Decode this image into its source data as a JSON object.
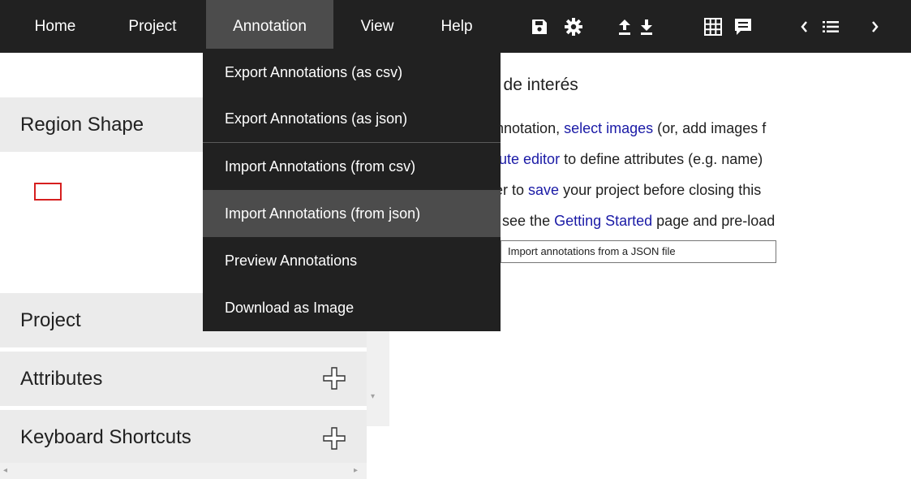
{
  "menubar": {
    "items": [
      {
        "label": "Home"
      },
      {
        "label": "Project"
      },
      {
        "label": "Annotation",
        "active": true
      },
      {
        "label": "View"
      },
      {
        "label": "Help"
      }
    ],
    "toolbar_icons": [
      "save-icon",
      "settings-icon",
      "upload-icon",
      "download-icon",
      "grid-icon",
      "comment-icon",
      "prev-icon",
      "list-icon",
      "next-icon"
    ]
  },
  "annotation_menu": {
    "items": [
      {
        "label": "Export Annotations (as csv)"
      },
      {
        "label": "Export Annotations (as json)"
      },
      {
        "label": "Import Annotations (from csv)"
      },
      {
        "label": "Import Annotations (from json)",
        "hovered": true
      },
      {
        "label": "Preview Annotations"
      },
      {
        "label": "Download as Image"
      }
    ]
  },
  "tooltip": {
    "text": "Import annotations from a JSON file"
  },
  "sidebar": {
    "region_shape": {
      "title": "Region Shape",
      "shape": "rectangle"
    },
    "sections": [
      {
        "label": "Project"
      },
      {
        "label": "Attributes"
      },
      {
        "label": "Keyboard Shortcuts"
      }
    ]
  },
  "content": {
    "title": "etos de interés",
    "line1": {
      "a": "art annotation, ",
      "link": "select images",
      "b": " (or, add images f"
    },
    "line2": {
      "link": "attribute editor",
      "b": " to define attributes (e.g. name)"
    },
    "line3": {
      "a": "ember to ",
      "link": "save",
      "b": " your project before closing this"
    },
    "line4": {
      "a": "help, see the ",
      "link": "Getting Started",
      "b": " page and pre-load"
    }
  },
  "colors": {
    "menubar_bg": "#212121",
    "active_menu_bg": "#4c4c4c",
    "link": "#1a1aa6",
    "rect_shape": "#d61f1f",
    "panel_bg": "#ebebeb"
  }
}
